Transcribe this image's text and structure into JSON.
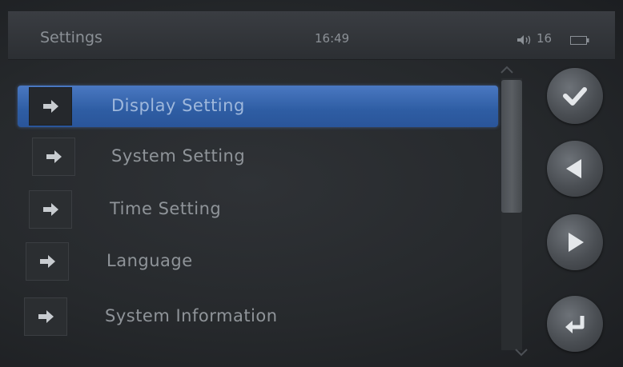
{
  "header": {
    "title": "Settings",
    "time": "16:49",
    "volume": "16"
  },
  "menu": {
    "items": [
      {
        "label": "Display Setting",
        "selected": true
      },
      {
        "label": "System Setting",
        "selected": false
      },
      {
        "label": "Time Setting",
        "selected": false
      },
      {
        "label": "Language",
        "selected": false
      },
      {
        "label": "System Information",
        "selected": false
      }
    ]
  },
  "side_buttons": [
    "confirm-icon",
    "left-arrow-icon",
    "right-arrow-icon",
    "enter-return-icon"
  ],
  "colors": {
    "selected_bar": "#3a6ab4",
    "text": "#8f9499"
  }
}
